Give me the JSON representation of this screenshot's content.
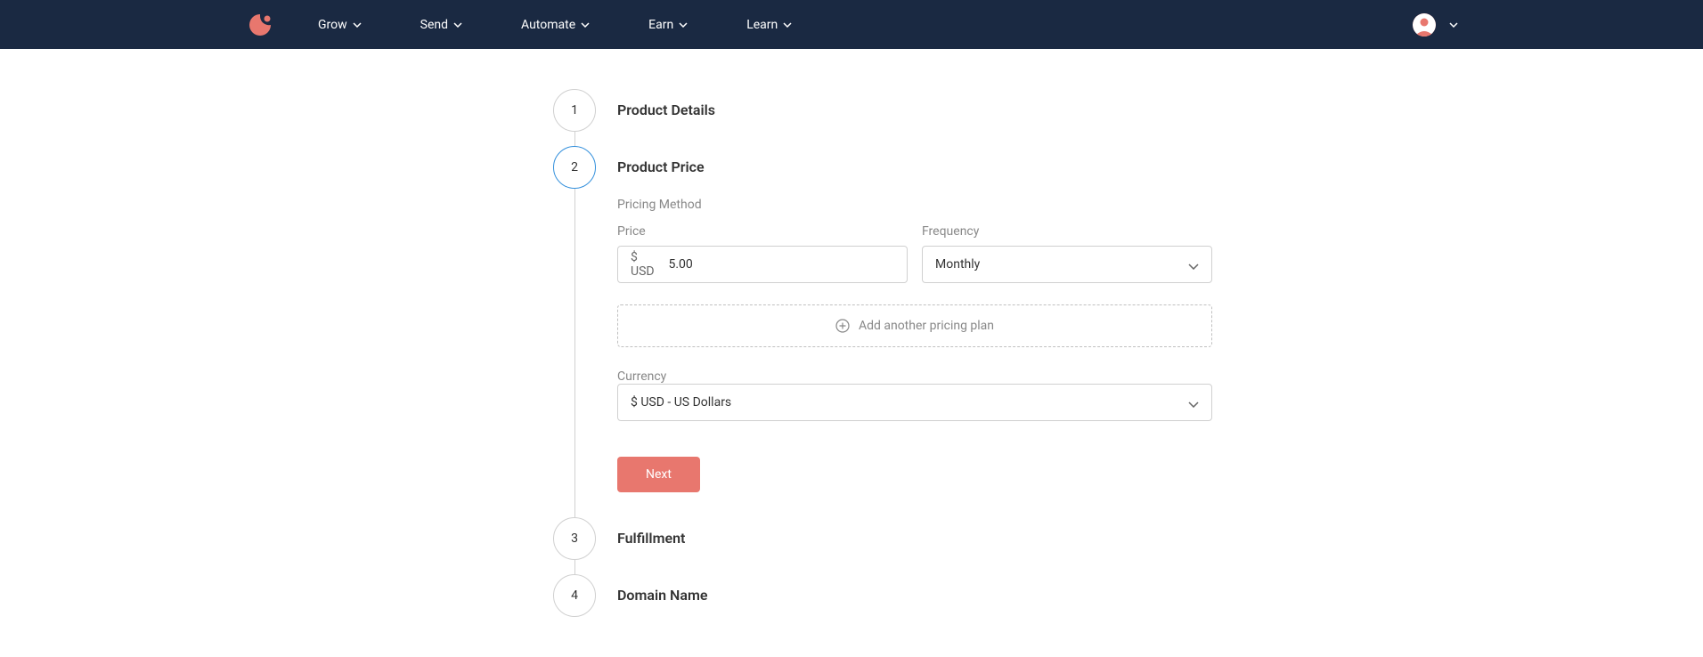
{
  "nav": {
    "items": [
      "Grow",
      "Send",
      "Automate",
      "Earn",
      "Learn"
    ]
  },
  "steps": {
    "step1": {
      "number": "1",
      "title": "Product Details"
    },
    "step2": {
      "number": "2",
      "title": "Product Price"
    },
    "step3": {
      "number": "3",
      "title": "Fulfillment"
    },
    "step4": {
      "number": "4",
      "title": "Domain Name"
    }
  },
  "form": {
    "pricing_method_label": "Pricing Method",
    "price_label": "Price",
    "price_prefix": "$ USD",
    "price_value": "5.00",
    "frequency_label": "Frequency",
    "frequency_value": "Monthly",
    "add_plan_label": "Add another pricing plan",
    "currency_label": "Currency",
    "currency_value": "$ USD - US Dollars",
    "next_button": "Next"
  }
}
